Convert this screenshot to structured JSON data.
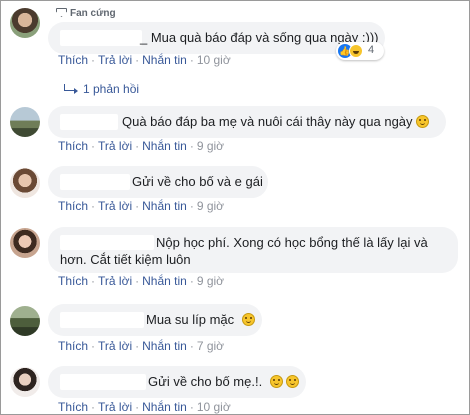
{
  "comments": [
    {
      "badge": "Fan cứng",
      "text": "_ Mua quà báo đáp và sống qua ngày :)))",
      "reaction_count": "4",
      "actions": {
        "like": "Thích",
        "reply": "Trả lời",
        "message": "Nhắn tin",
        "time": "10 giờ"
      },
      "replies_label": "1 phản hồi"
    },
    {
      "text": "Quà báo đáp ba mẹ và nuôi cái thây này qua ngày",
      "actions": {
        "like": "Thích",
        "reply": "Trả lời",
        "message": "Nhắn tin",
        "time": "9 giờ"
      }
    },
    {
      "text": "Gửi về cho bố và e gái",
      "actions": {
        "like": "Thích",
        "reply": "Trả lời",
        "message": "Nhắn tin",
        "time": "9 giờ"
      }
    },
    {
      "text_line1": "Nộp học phí. Xong có học bổng thế là lấy lại và",
      "text_line2": "hơn. Cắt tiết kiệm luôn",
      "actions": {
        "like": "Thích",
        "reply": "Trả lời",
        "message": "Nhắn tin",
        "time": "9 giờ"
      }
    },
    {
      "text": "Mua su líp mặc",
      "actions": {
        "like": "Thích",
        "reply": "Trả lời",
        "message": "Nhắn tin",
        "time": "7 giờ"
      }
    },
    {
      "text": "Gửi về cho bố mẹ.!.",
      "actions": {
        "like": "Thích",
        "reply": "Trả lời",
        "message": "Nhắn tin",
        "time": "10 giờ"
      }
    }
  ],
  "separator": "·"
}
